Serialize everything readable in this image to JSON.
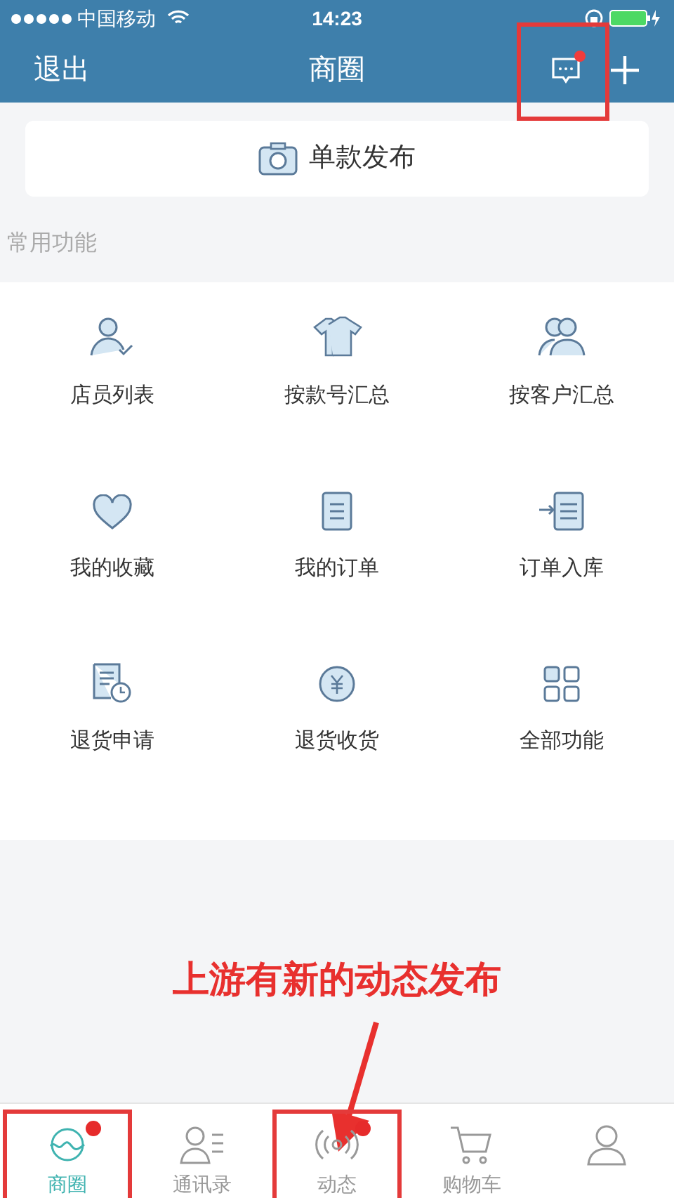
{
  "status_bar": {
    "carrier": "中国移动",
    "time": "14:23"
  },
  "nav": {
    "back": "退出",
    "title": "商圈",
    "message_badge": true
  },
  "publish_button": {
    "label": "单款发布"
  },
  "section_title": "常用功能",
  "features": [
    {
      "label": "店员列表"
    },
    {
      "label": "按款号汇总"
    },
    {
      "label": "按客户汇总"
    },
    {
      "label": "我的收藏"
    },
    {
      "label": "我的订单"
    },
    {
      "label": "订单入库"
    },
    {
      "label": "退货申请"
    },
    {
      "label": "退货收货"
    },
    {
      "label": "全部功能"
    }
  ],
  "annotation": "上游有新的动态发布",
  "tabs": [
    {
      "label": "商圈",
      "selected": true,
      "badge": true,
      "highlighted": true
    },
    {
      "label": "通讯录",
      "selected": false,
      "badge": false,
      "highlighted": false
    },
    {
      "label": "动态",
      "selected": false,
      "badge": true,
      "highlighted": true
    },
    {
      "label": "购物车",
      "selected": false,
      "badge": false,
      "highlighted": false
    },
    {
      "selected": false,
      "badge": false,
      "highlighted": false
    }
  ]
}
